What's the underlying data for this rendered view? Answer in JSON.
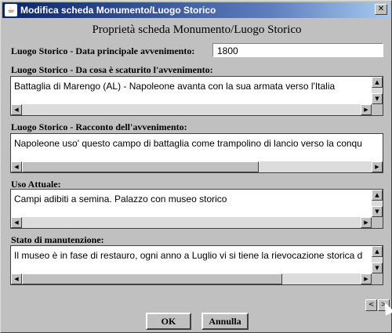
{
  "window": {
    "title": "Modifica scheda Monumento/Luogo Storico",
    "close_glyph": "✕"
  },
  "heading": "Proprietà scheda Monumento/Luogo Storico",
  "fields": {
    "data_label": "Luogo Storico - Data principale avvenimento:",
    "data_value": "1800",
    "scaturito_label": "Luogo Storico - Da cosa è scaturito l'avvenimento:",
    "scaturito_text": "Battaglia di Marengo (AL) - Napoleone avanta con la sua armata verso l'Italia",
    "racconto_label": "Luogo Storico - Racconto dell'avvenimento:",
    "racconto_text": "Napoleone uso' questo campo di battaglia come trampolino di lancio verso la conqu",
    "uso_label": "Uso Attuale:",
    "uso_text": "Campi adibiti a semina. Palazzo con museo storico",
    "manutenzione_label": "Stato di manutenzione:",
    "manutenzione_text": "Il museo è in fase di restauro, ogni anno a Luglio vi si tiene la rievocazione storica d"
  },
  "icons": {
    "up": "▲",
    "down": "▼",
    "left": "◀",
    "right": "▶"
  },
  "buttons": {
    "ok": "OK",
    "annulla": "Annulla",
    "nav_prev": "<",
    "nav_next": ">"
  }
}
